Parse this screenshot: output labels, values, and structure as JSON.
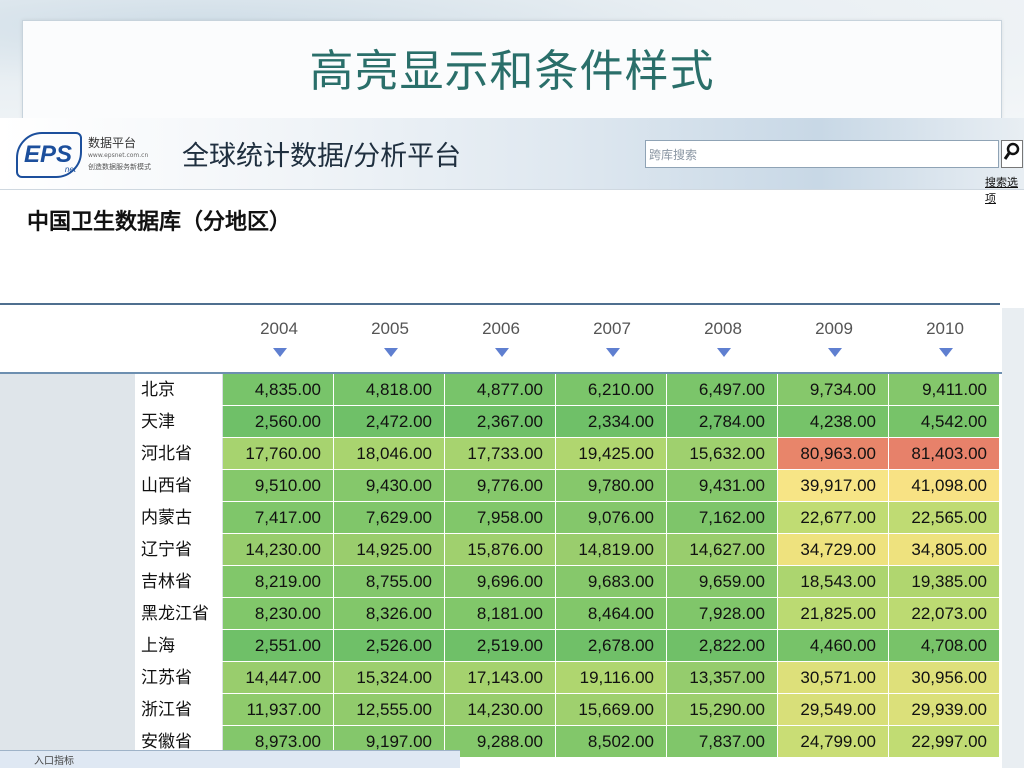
{
  "slide": {
    "title": "高亮显示和条件样式"
  },
  "header": {
    "logo_text": "EPS",
    "logo_net": "net",
    "logo_name": "数据平台",
    "logo_url": "www.epsnet.com.cn",
    "logo_slogan": "创造数据服务新模式",
    "platform_title": "全球统计数据/分析平台",
    "search_placeholder": "跨库搜索",
    "search_options_label": "搜索选项"
  },
  "database": {
    "title": "中国卫生数据库（分地区）"
  },
  "table": {
    "years": [
      "2004",
      "2005",
      "2006",
      "2007",
      "2008",
      "2009",
      "2010"
    ],
    "rows": [
      {
        "region": "北京",
        "values": [
          "4,835.00",
          "4,818.00",
          "4,877.00",
          "6,210.00",
          "6,497.00",
          "9,734.00",
          "9,411.00"
        ],
        "colors": [
          "#78c46a",
          "#78c46a",
          "#78c46a",
          "#7bc56a",
          "#7bc56a",
          "#86c86b",
          "#84c76b"
        ]
      },
      {
        "region": "天津",
        "values": [
          "2,560.00",
          "2,472.00",
          "2,367.00",
          "2,334.00",
          "2,784.00",
          "4,238.00",
          "4,542.00"
        ],
        "colors": [
          "#6fc068",
          "#6fc068",
          "#6fc068",
          "#6fc068",
          "#70c068",
          "#76c369",
          "#77c369"
        ]
      },
      {
        "region": "河北省",
        "values": [
          "17,760.00",
          "18,046.00",
          "17,733.00",
          "19,425.00",
          "15,632.00",
          "80,963.00",
          "81,403.00"
        ],
        "colors": [
          "#a7d36f",
          "#a9d46f",
          "#a7d36f",
          "#b0d66f",
          "#9fd06e",
          "#e8856a",
          "#e7816a"
        ]
      },
      {
        "region": "山西省",
        "values": [
          "9,510.00",
          "9,430.00",
          "9,776.00",
          "9,780.00",
          "9,431.00",
          "39,917.00",
          "41,098.00"
        ],
        "colors": [
          "#85c86b",
          "#85c86b",
          "#86c86b",
          "#86c86b",
          "#85c86b",
          "#f7e586",
          "#f8e284"
        ]
      },
      {
        "region": "内蒙古",
        "values": [
          "7,417.00",
          "7,629.00",
          "7,958.00",
          "9,076.00",
          "7,162.00",
          "22,677.00",
          "22,565.00"
        ],
        "colors": [
          "#7fc66a",
          "#80c66a",
          "#81c76a",
          "#84c76b",
          "#7ec56a",
          "#c0dc73",
          "#bfdb73"
        ]
      },
      {
        "region": "辽宁省",
        "values": [
          "14,230.00",
          "14,925.00",
          "15,876.00",
          "14,819.00",
          "14,627.00",
          "34,729.00",
          "34,805.00"
        ],
        "colors": [
          "#98cd6d",
          "#9acd6d",
          "#a0d06e",
          "#9acd6d",
          "#99cd6d",
          "#eee27e",
          "#eee27e"
        ]
      },
      {
        "region": "吉林省",
        "values": [
          "8,219.00",
          "8,755.00",
          "9,696.00",
          "9,683.00",
          "9,659.00",
          "18,543.00",
          "19,385.00"
        ],
        "colors": [
          "#81c76a",
          "#83c76b",
          "#86c86b",
          "#86c86b",
          "#86c86b",
          "#acd56f",
          "#b0d66f"
        ]
      },
      {
        "region": "黑龙江省",
        "values": [
          "8,230.00",
          "8,326.00",
          "8,181.00",
          "8,464.00",
          "7,928.00",
          "21,825.00",
          "22,073.00"
        ],
        "colors": [
          "#81c76a",
          "#82c76a",
          "#81c76a",
          "#82c76a",
          "#80c66a",
          "#bbda72",
          "#bcda72"
        ]
      },
      {
        "region": "上海",
        "values": [
          "2,551.00",
          "2,526.00",
          "2,519.00",
          "2,678.00",
          "2,822.00",
          "4,460.00",
          "4,708.00"
        ],
        "colors": [
          "#6fc068",
          "#6fc068",
          "#6fc068",
          "#70c068",
          "#70c068",
          "#77c369",
          "#78c369"
        ]
      },
      {
        "region": "江苏省",
        "values": [
          "14,447.00",
          "15,324.00",
          "17,143.00",
          "19,116.00",
          "13,357.00",
          "30,571.00",
          "30,956.00"
        ],
        "colors": [
          "#99cd6d",
          "#9ccf6e",
          "#a5d26e",
          "#afd66f",
          "#95cc6d",
          "#dde07a",
          "#dee07a"
        ]
      },
      {
        "region": "浙江省",
        "values": [
          "11,937.00",
          "12,555.00",
          "14,230.00",
          "15,669.00",
          "15,290.00",
          "29,549.00",
          "29,939.00"
        ],
        "colors": [
          "#8fcb6c",
          "#91cb6c",
          "#98cd6d",
          "#9fd06e",
          "#9dcf6e",
          "#d8df79",
          "#dbe07a"
        ]
      },
      {
        "region": "安徽省",
        "values": [
          "8,973.00",
          "9,197.00",
          "9,288.00",
          "8,502.00",
          "7,837.00",
          "24,799.00",
          "22,997.00"
        ],
        "colors": [
          "#83c76b",
          "#84c76b",
          "#84c86b",
          "#82c76a",
          "#80c66a",
          "#c9dd75",
          "#c1dc73"
        ]
      }
    ]
  },
  "footer": {
    "partial_label": "入口指标"
  }
}
